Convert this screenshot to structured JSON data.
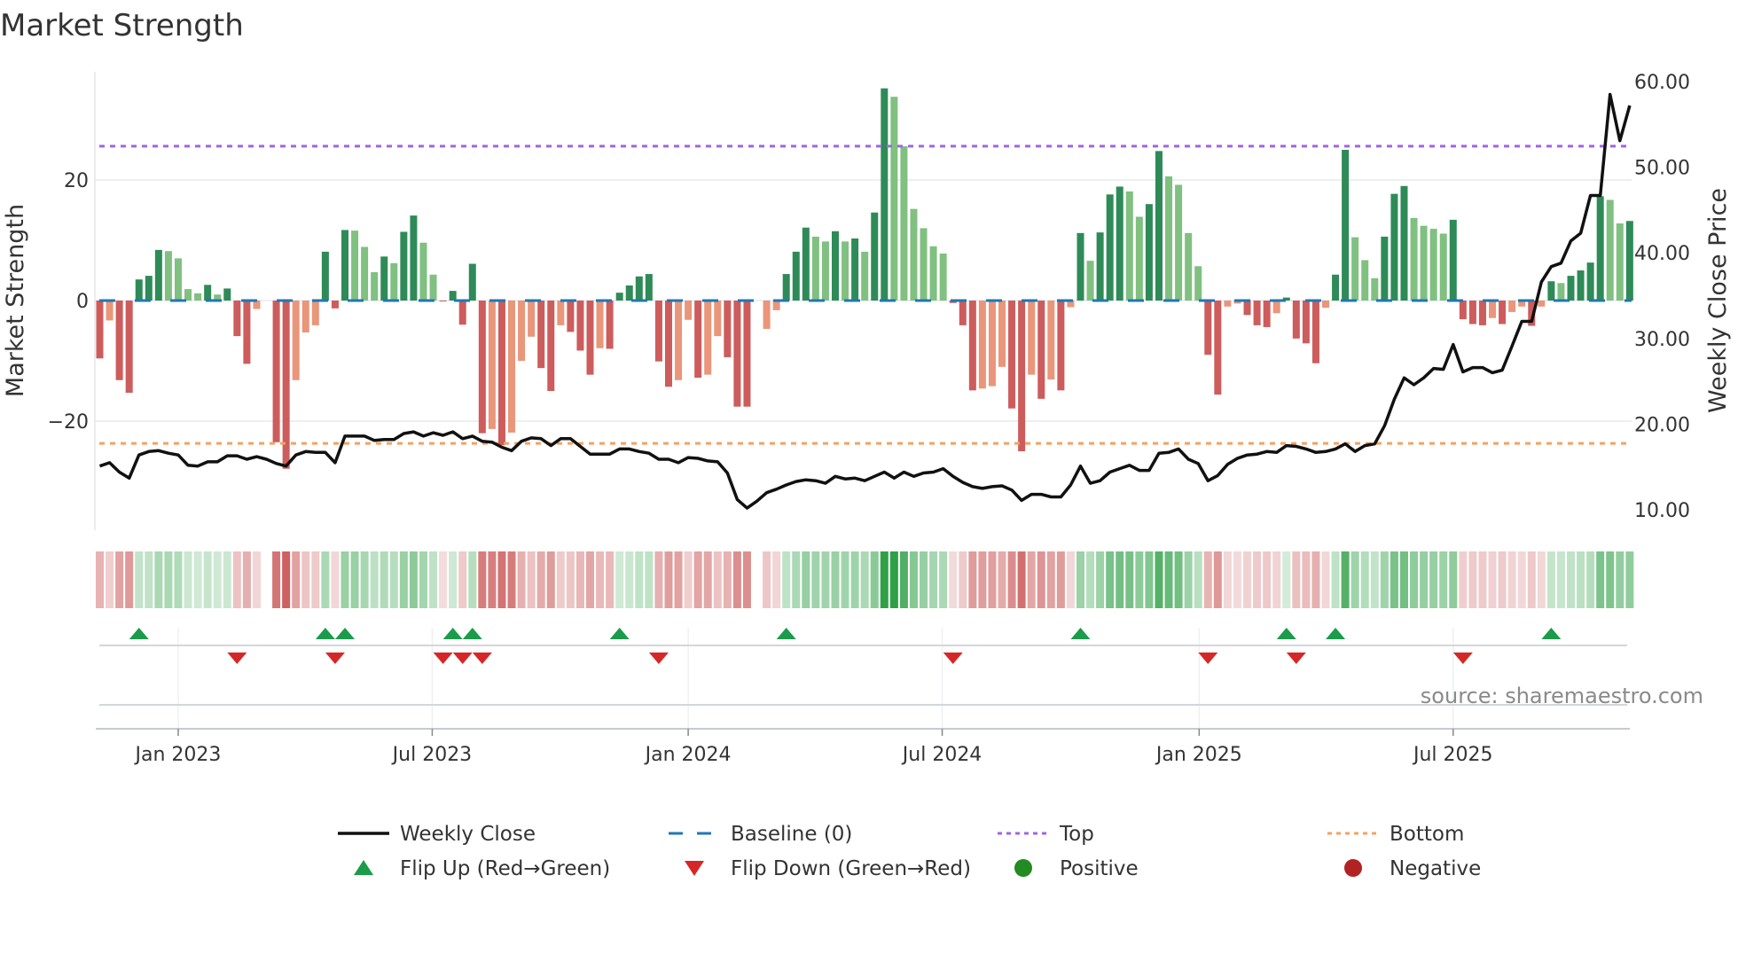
{
  "title": "Market Strength",
  "source": "source: sharemaestro.com",
  "colors": {
    "pos_strong": "#2e8b57",
    "pos_weak": "#80c080",
    "neg_strong": "#cd5c5c",
    "neg_weak": "#e9967a",
    "close": "#111111",
    "baseline": "#1f77b4",
    "top": "#a066e0",
    "bottom": "#f4a261",
    "flip_up": "#1a9c4a",
    "flip_down": "#d62728",
    "positive": "#228b22",
    "negative": "#b22222"
  },
  "chart_data": {
    "type": "bar",
    "title": "Market Strength",
    "ylabel": "Market Strength",
    "y2label": "Weekly Close Price",
    "ylim": [
      -38,
      38.5
    ],
    "y2lim": [
      4.8,
      60
    ],
    "grid": true,
    "legend_placement": "bottom",
    "left_ticks": [
      {
        "v": 20,
        "label": "20"
      },
      {
        "v": 0,
        "label": "0"
      },
      {
        "v": -20,
        "label": "−20"
      }
    ],
    "right_ticks": [
      {
        "v": 60,
        "label": "60.00"
      },
      {
        "v": 50,
        "label": "50.00"
      },
      {
        "v": 40,
        "label": "40.00"
      },
      {
        "v": 30,
        "label": "30.00"
      },
      {
        "v": 20,
        "label": "20.00"
      },
      {
        "v": 10,
        "label": "10.00"
      }
    ],
    "x_ticks": [
      {
        "week": 9,
        "label": "Jan 2023"
      },
      {
        "week": 34.9,
        "label": "Jul 2023"
      },
      {
        "week": 61,
        "label": "Jan 2024"
      },
      {
        "week": 86.9,
        "label": "Jul 2024"
      },
      {
        "week": 113.1,
        "label": "Jan 2025"
      },
      {
        "week": 139,
        "label": "Jul 2025"
      }
    ],
    "top_level": 25.6,
    "bottom_level": -23.7,
    "baseline": 0,
    "strength": [
      -9.6,
      -3.3,
      -13.2,
      -15.3,
      3.5,
      4.1,
      8.4,
      8.2,
      7.0,
      1.9,
      1.2,
      2.6,
      1.0,
      2.0,
      -5.9,
      -10.5,
      -1.4,
      0,
      -23.5,
      -27.9,
      -13.2,
      -5.3,
      -4.1,
      8.1,
      -1.3,
      11.7,
      11.6,
      8.9,
      4.7,
      7.3,
      6.2,
      11.4,
      14.1,
      9.6,
      4.3,
      -0.1,
      1.6,
      -4.0,
      6.1,
      -22.0,
      -21.3,
      -24.0,
      -21.9,
      -10.0,
      -6.0,
      -11.2,
      -15.0,
      -4.1,
      -5.2,
      -8.3,
      -12.3,
      -7.9,
      -8.0,
      1.3,
      2.5,
      4.0,
      4.4,
      -10.1,
      -14.3,
      -13.2,
      -3.2,
      -12.8,
      -12.3,
      -5.9,
      -9.4,
      -17.6,
      -17.6,
      0,
      -4.7,
      -1.6,
      4.4,
      8.1,
      12.1,
      10.6,
      9.8,
      11.5,
      9.8,
      10.3,
      8.1,
      14.6,
      35.2,
      33.8,
      25.6,
      15.2,
      12.0,
      9.0,
      7.8,
      -0.4,
      -4.1,
      -14.9,
      -14.6,
      -14.2,
      -11.0,
      -17.9,
      -25.0,
      -12.3,
      -16.3,
      -13.1,
      -14.9,
      -1.1,
      11.2,
      6.6,
      11.3,
      17.6,
      18.9,
      18.1,
      13.9,
      16.0,
      24.8,
      20.6,
      19.2,
      11.2,
      5.7,
      -9.0,
      -15.6,
      -1.0,
      -0.5,
      -2.4,
      -4.1,
      -4.4,
      -2.1,
      0.5,
      -6.3,
      -7.1,
      -10.4,
      -1.2,
      4.3,
      25.0,
      10.5,
      6.7,
      3.7,
      10.6,
      17.7,
      19.0,
      13.7,
      12.4,
      11.9,
      11.1,
      13.4,
      -3.1,
      -3.9,
      -4.1,
      -2.9,
      -3.9,
      -1.9,
      -1.0,
      -4.2,
      -1.0,
      3.2,
      2.9,
      4.1,
      5.0,
      6.3,
      17.3,
      16.7,
      12.8,
      13.2
    ],
    "weekly_close": [
      15.1,
      15.5,
      14.4,
      13.7,
      16.4,
      16.8,
      16.9,
      16.6,
      16.4,
      15.2,
      15.1,
      15.6,
      15.6,
      16.3,
      16.3,
      15.9,
      16.2,
      15.9,
      15.4,
      15.1,
      16.4,
      16.8,
      16.7,
      16.7,
      15.5,
      18.6,
      18.6,
      18.6,
      18.1,
      18.2,
      18.2,
      18.9,
      19.1,
      18.6,
      19.0,
      18.7,
      19.1,
      18.3,
      18.6,
      18.0,
      17.9,
      17.3,
      16.9,
      18.0,
      18.4,
      18.3,
      17.5,
      18.3,
      18.3,
      17.4,
      16.5,
      16.5,
      16.5,
      17.1,
      17.1,
      16.8,
      16.6,
      15.9,
      15.9,
      15.5,
      16.1,
      16.0,
      15.7,
      15.6,
      14.3,
      11.2,
      10.2,
      11.0,
      12.0,
      12.4,
      12.9,
      13.3,
      13.5,
      13.4,
      13.1,
      13.9,
      13.6,
      13.7,
      13.4,
      13.9,
      14.4,
      13.7,
      14.4,
      13.9,
      14.3,
      14.4,
      14.8,
      13.9,
      13.2,
      12.7,
      12.5,
      12.7,
      12.8,
      12.3,
      11.1,
      11.8,
      11.8,
      11.5,
      11.5,
      12.9,
      15.1,
      13.1,
      13.4,
      14.4,
      14.8,
      15.2,
      14.6,
      14.6,
      16.6,
      16.7,
      17.1,
      15.9,
      15.4,
      13.4,
      14.0,
      15.3,
      16.0,
      16.4,
      16.5,
      16.8,
      16.7,
      17.5,
      17.4,
      17.1,
      16.7,
      16.8,
      17.1,
      17.7,
      16.8,
      17.5,
      17.7,
      19.8,
      22.9,
      25.4,
      24.6,
      25.4,
      26.5,
      26.4,
      29.3,
      26.1,
      26.6,
      26.6,
      26.0,
      26.3,
      29.1,
      32.0,
      32.0,
      36.6,
      38.4,
      38.8,
      41.4,
      42.3,
      46.7,
      46.7,
      58.5,
      53.1,
      57.2
    ],
    "flip_up_weeks": [
      5,
      24,
      26,
      37,
      39,
      54,
      71,
      101,
      122,
      127,
      149
    ],
    "flip_down_weeks": [
      15,
      25,
      36,
      38,
      40,
      58,
      88,
      114,
      123,
      140
    ],
    "legend": [
      {
        "key": "close",
        "label": "Weekly Close",
        "symbol": "line"
      },
      {
        "key": "baseline",
        "label": "Baseline (0)",
        "symbol": "dash"
      },
      {
        "key": "top",
        "label": "Top",
        "symbol": "dot"
      },
      {
        "key": "bottom",
        "label": "Bottom",
        "symbol": "dot"
      },
      {
        "key": "flip_up",
        "label": "Flip Up (Red→Green)",
        "symbol": "tri-up"
      },
      {
        "key": "flip_down",
        "label": "Flip Down (Green→Red)",
        "symbol": "tri-down"
      },
      {
        "key": "positive",
        "label": "Positive",
        "symbol": "circle"
      },
      {
        "key": "negative",
        "label": "Negative",
        "symbol": "circle"
      }
    ]
  }
}
